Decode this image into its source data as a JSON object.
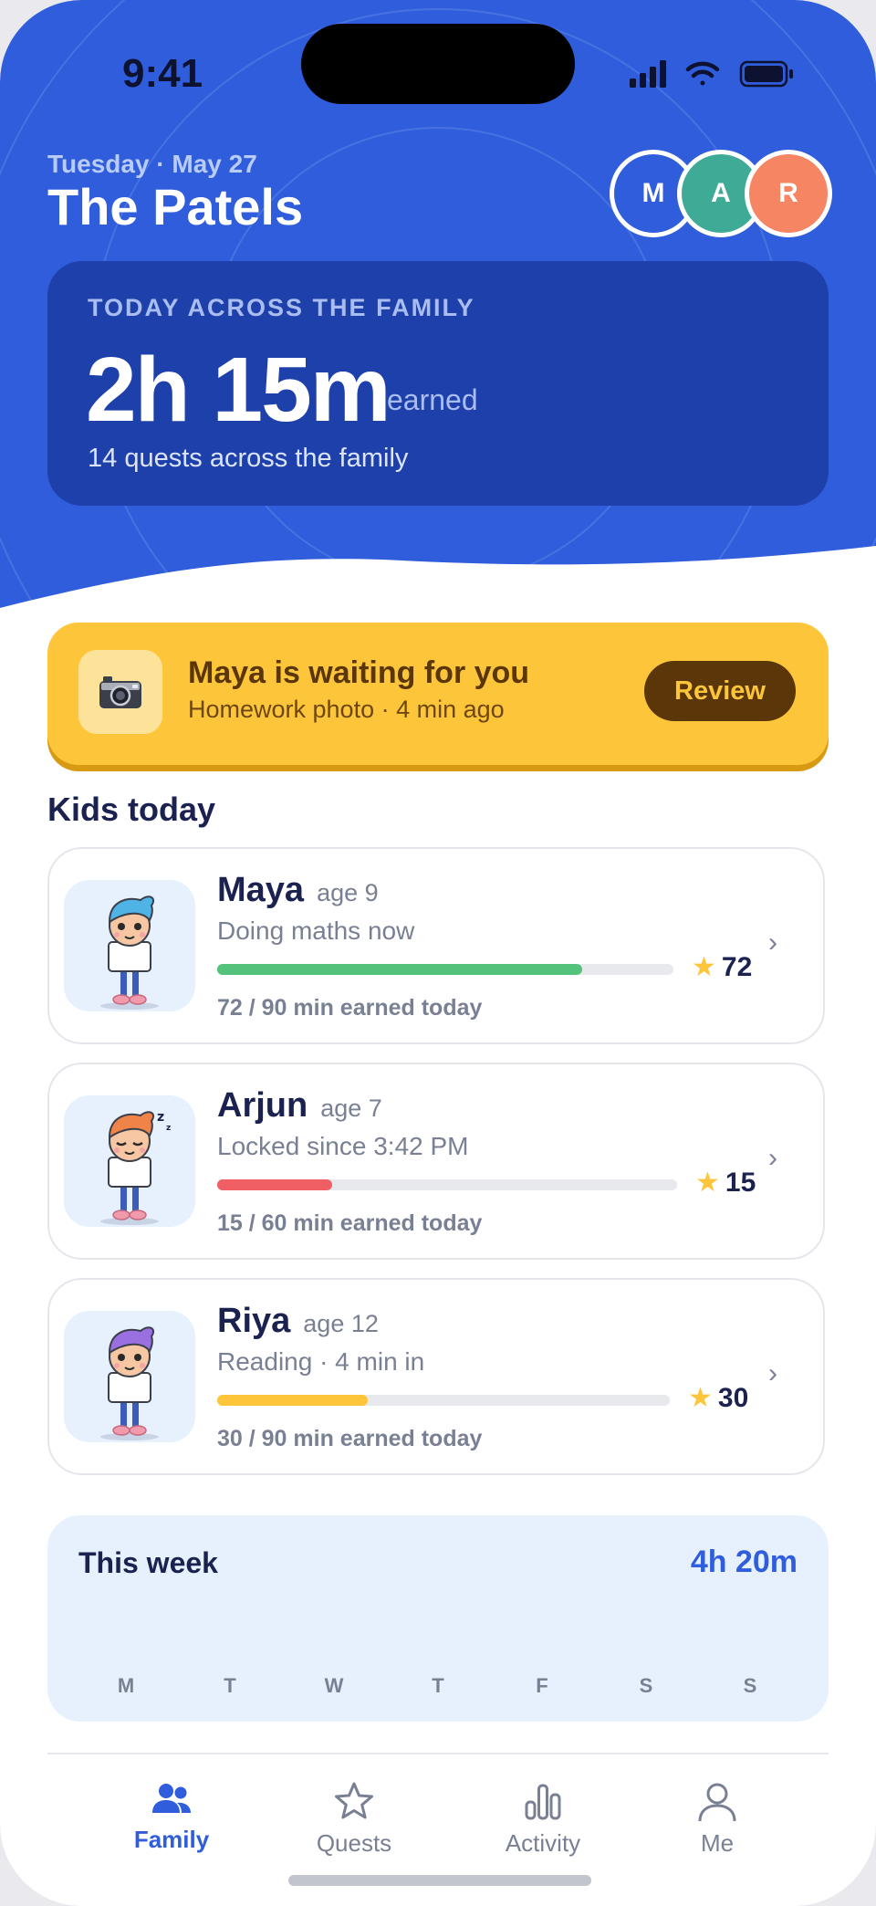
{
  "status_bar": {
    "time": "9:41"
  },
  "header": {
    "date": "Tuesday · May 27",
    "title": "The Patels",
    "avatars": [
      {
        "initial": "M",
        "color": "#2f5ddb"
      },
      {
        "initial": "A",
        "color": "#3fab96"
      },
      {
        "initial": "R",
        "color": "#f58563"
      }
    ]
  },
  "summary": {
    "label": "TODAY ACROSS THE FAMILY",
    "value": "2h 15m",
    "unit": "earned",
    "subtitle": "14 quests across the family"
  },
  "alert": {
    "icon": "camera-icon",
    "title": "Maya is waiting for you",
    "subtitle": "Homework photo · 4 min ago",
    "button": "Review"
  },
  "kids_section": {
    "title": "Kids today"
  },
  "kids": [
    {
      "name": "Maya",
      "age": "age 9",
      "status": "Doing maths now",
      "progress": 0.8,
      "bar_color": "#53c27b",
      "stars": "72",
      "earned": "72 / 90 min earned today",
      "hair": "#4fb3e6",
      "sleeping": false
    },
    {
      "name": "Arjun",
      "age": "age 7",
      "status": "Locked since 3:42 PM",
      "progress": 0.25,
      "bar_color": "#ef5f63",
      "stars": "15",
      "earned": "15 / 60 min earned today",
      "hair": "#f08348",
      "sleeping": true,
      "sleep_text": "z"
    },
    {
      "name": "Riya",
      "age": "age 12",
      "status": "Reading · 4 min in",
      "progress": 0.333,
      "bar_color": "#fdc63a",
      "stars": "30",
      "earned": "30 / 90 min earned today",
      "hair": "#9a6fe0",
      "sleeping": false
    }
  ],
  "week": {
    "title": "This week",
    "total": "4h 20m",
    "days": [
      "M",
      "T",
      "W",
      "T",
      "F",
      "S",
      "S"
    ]
  },
  "tabs": [
    {
      "label": "Family",
      "icon": "family-icon",
      "active": true
    },
    {
      "label": "Quests",
      "icon": "star-icon",
      "active": false
    },
    {
      "label": "Activity",
      "icon": "bar-chart-icon",
      "active": false
    },
    {
      "label": "Me",
      "icon": "person-icon",
      "active": false
    }
  ],
  "colors": {
    "primary": "#2f5ddb",
    "alert": "#fdc63a",
    "text_dark": "#1b2250"
  }
}
